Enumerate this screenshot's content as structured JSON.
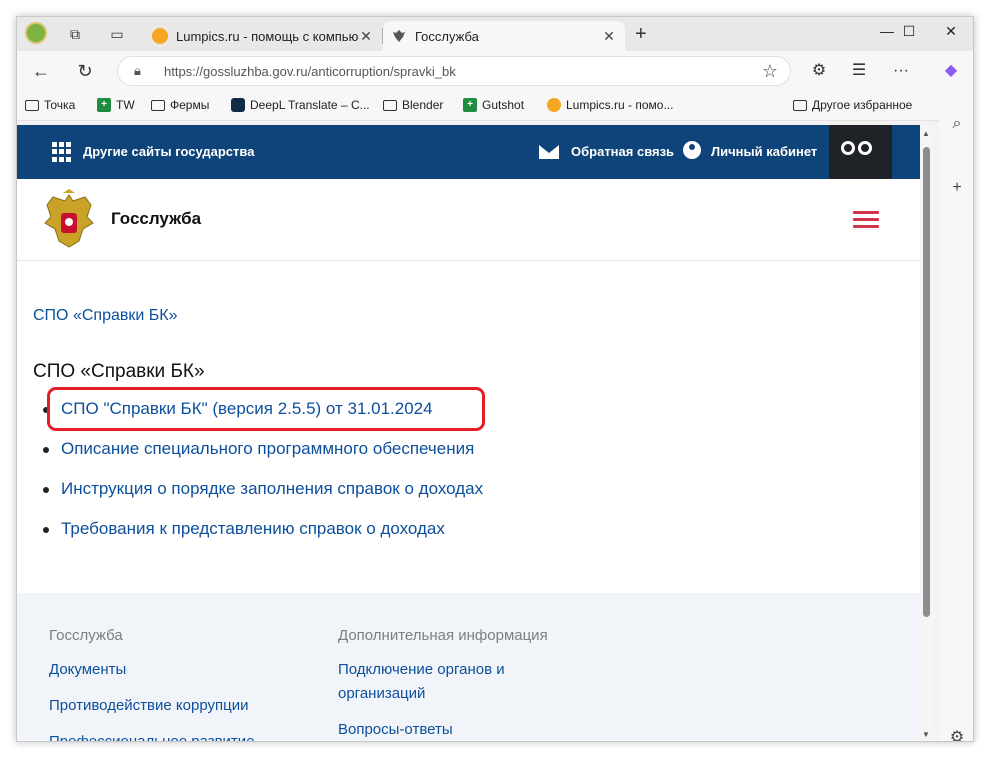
{
  "browser": {
    "tabs": [
      {
        "title": "Lumpics.ru - помощь с компьютером",
        "active": false
      },
      {
        "title": "Госслужба",
        "active": true
      }
    ],
    "url": "https://gossluzhba.gov.ru/anticorruption/spravki_bk",
    "bookmarks": [
      {
        "label": "Точка",
        "icon": "folder-icon"
      },
      {
        "label": "TW",
        "icon": "green-square-icon"
      },
      {
        "label": "Фермы",
        "icon": "folder-icon"
      },
      {
        "label": "DeepL Translate – С...",
        "icon": "deepl-icon"
      },
      {
        "label": "Blender",
        "icon": "folder-icon"
      },
      {
        "label": "Gutshot",
        "icon": "green-square-icon"
      },
      {
        "label": "Lumpics.ru - помо...",
        "icon": "orange-icon"
      }
    ],
    "other_favorites": "Другое избранное"
  },
  "site": {
    "topbar": {
      "other_sites": "Другие сайты государства",
      "feedback": "Обратная связь",
      "cabinet": "Личный кабинет"
    },
    "name": "Госслужба",
    "breadcrumb": "СПО «Справки БК»",
    "heading": "СПО «Справки БК»",
    "links": [
      "СПО \"Справки БК\" (версия 2.5.5) от 31.01.2024",
      "Описание специального программного обеспечения",
      "Инструкция о порядке заполнения справок о доходах",
      "Требования к представлению справок о доходах"
    ],
    "footer": {
      "col1": {
        "heading": "Госслужба",
        "links": [
          "Документы",
          "Противодействие коррупции",
          "Профессиональное развитие"
        ]
      },
      "col2": {
        "heading": "Дополнительная информация",
        "links": [
          "Подключение органов и организаций",
          "Вопросы-ответы"
        ]
      }
    }
  },
  "colors": {
    "topbar": "#0e4479",
    "link": "#0d4f9c",
    "highlight": "#e41e26",
    "burger": "#d1354a"
  }
}
